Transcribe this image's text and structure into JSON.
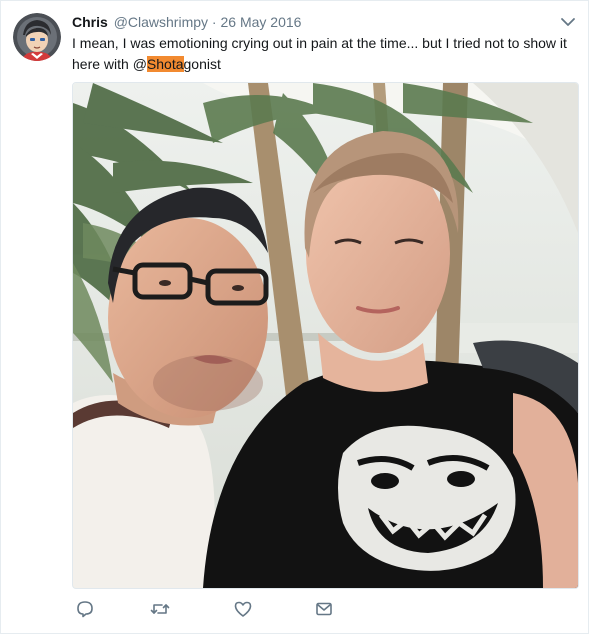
{
  "tweet": {
    "display_name": "Chris",
    "handle": "@Clawshrimpy",
    "separator": "·",
    "date": "26 May 2016",
    "text_before": "I mean, I was emotioning crying out in pain at the time... but I tried not to show it here with ",
    "mention_prefix": "@",
    "mention_highlight": "Shota",
    "mention_rest": "gonist"
  },
  "colors": {
    "highlight": "#f28a30",
    "secondary_text": "#657786",
    "icon": "#657786"
  },
  "icons": {
    "menu": "chevron-down-icon",
    "reply": "reply-icon",
    "retweet": "retweet-icon",
    "like": "heart-icon",
    "dm": "envelope-icon"
  }
}
